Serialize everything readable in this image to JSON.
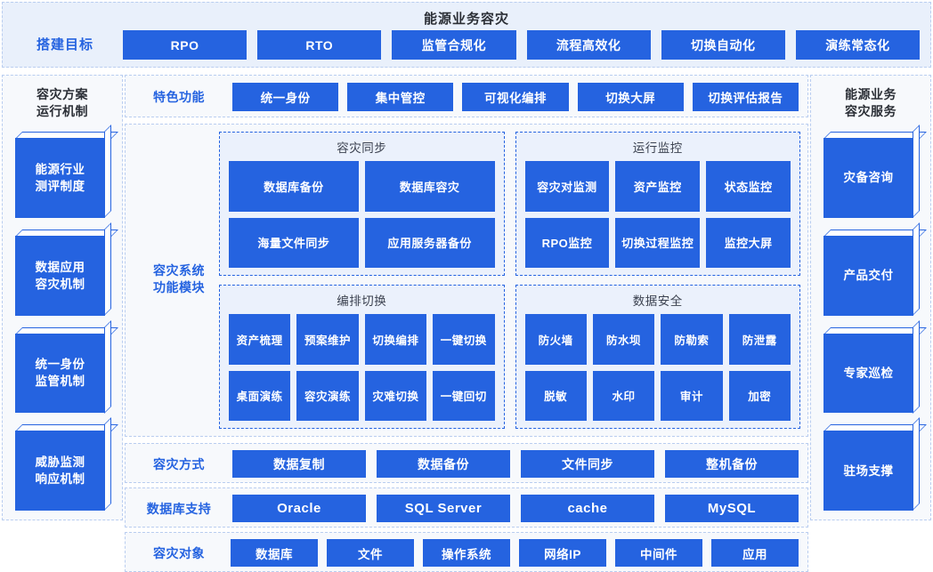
{
  "top": {
    "title": "能源业务容灾",
    "goal_label": "搭建目标",
    "goals": [
      "RPO",
      "RTO",
      "监管合规化",
      "流程高效化",
      "切换自动化",
      "演练常态化"
    ]
  },
  "left_sidebar": {
    "heading_line1": "容灾方案",
    "heading_line2": "运行机制",
    "items": [
      {
        "line1": "能源行业",
        "line2": "测评制度"
      },
      {
        "line1": "数据应用",
        "line2": "容灾机制"
      },
      {
        "line1": "统一身份",
        "line2": "监管机制"
      },
      {
        "line1": "威胁监测",
        "line2": "响应机制"
      }
    ]
  },
  "right_sidebar": {
    "heading_line1": "能源业务",
    "heading_line2": "容灾服务",
    "items": [
      {
        "line1": "灾备咨询",
        "line2": ""
      },
      {
        "line1": "产品交付",
        "line2": ""
      },
      {
        "line1": "专家巡检",
        "line2": ""
      },
      {
        "line1": "驻场支撑",
        "line2": ""
      }
    ]
  },
  "feature_row": {
    "label": "特色功能",
    "items": [
      "统一身份",
      "集中管控",
      "可视化编排",
      "切换大屏",
      "切换评估报告"
    ]
  },
  "modules": {
    "label_line1": "容灾系统",
    "label_line2": "功能模块",
    "panels": [
      {
        "title": "容灾同步",
        "columns": 2,
        "items": [
          "数据库备份",
          "数据库容灾",
          "海量文件同步",
          "应用服务器备份"
        ]
      },
      {
        "title": "运行监控",
        "columns": 3,
        "items": [
          "容灾对监测",
          "资产监控",
          "状态监控",
          "RPO监控",
          "切换过程监控",
          "监控大屏"
        ]
      },
      {
        "title": "编排切换",
        "columns": 4,
        "items": [
          "资产梳理",
          "预案维护",
          "切换编排",
          "一键切换",
          "桌面演练",
          "容灾演练",
          "灾难切换",
          "一键回切"
        ]
      },
      {
        "title": "数据安全",
        "columns": 4,
        "items": [
          "防火墙",
          "防水坝",
          "防勒索",
          "防泄露",
          "脱敏",
          "水印",
          "审计",
          "加密"
        ]
      }
    ]
  },
  "way_row": {
    "label": "容灾方式",
    "items": [
      "数据复制",
      "数据备份",
      "文件同步",
      "整机备份"
    ]
  },
  "db_row": {
    "label": "数据库支持",
    "items": [
      "Oracle",
      "SQL Server",
      "cache",
      "MySQL"
    ]
  },
  "object_row": {
    "label": "容灾对象",
    "items": [
      "数据库",
      "文件",
      "操作系统",
      "网络IP",
      "中间件",
      "应用"
    ]
  },
  "colors": {
    "accent": "#2563e0",
    "band_top_bg": "#e9f0fb",
    "band_bg": "#f7f9fc",
    "panel_bg": "#ebf1fc",
    "border_dashed": "#b9cdf0",
    "title_text": "#2b2f36"
  }
}
